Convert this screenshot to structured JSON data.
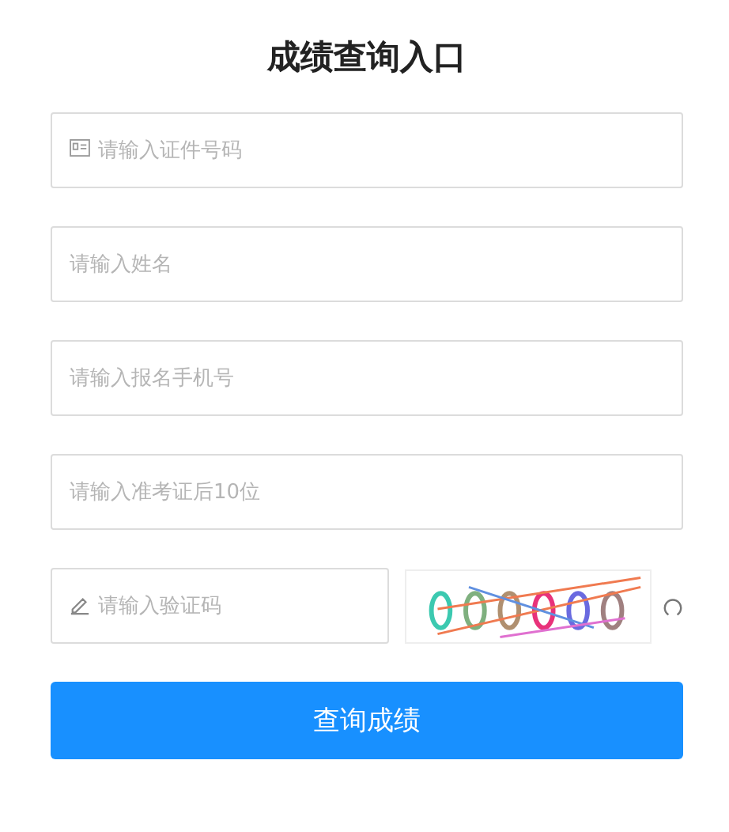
{
  "title": "成绩查询入口",
  "fields": [
    {
      "kind": "card",
      "placeholder": "请输入证件号码"
    },
    {
      "kind": "plain",
      "placeholder": "请输入姓名"
    },
    {
      "kind": "plain",
      "placeholder": "请输入报名手机号"
    },
    {
      "kind": "plain",
      "placeholder": "请输入准考证后10位"
    }
  ],
  "captcha": {
    "placeholder": "请输入验证码"
  },
  "submit": "查询成绩"
}
